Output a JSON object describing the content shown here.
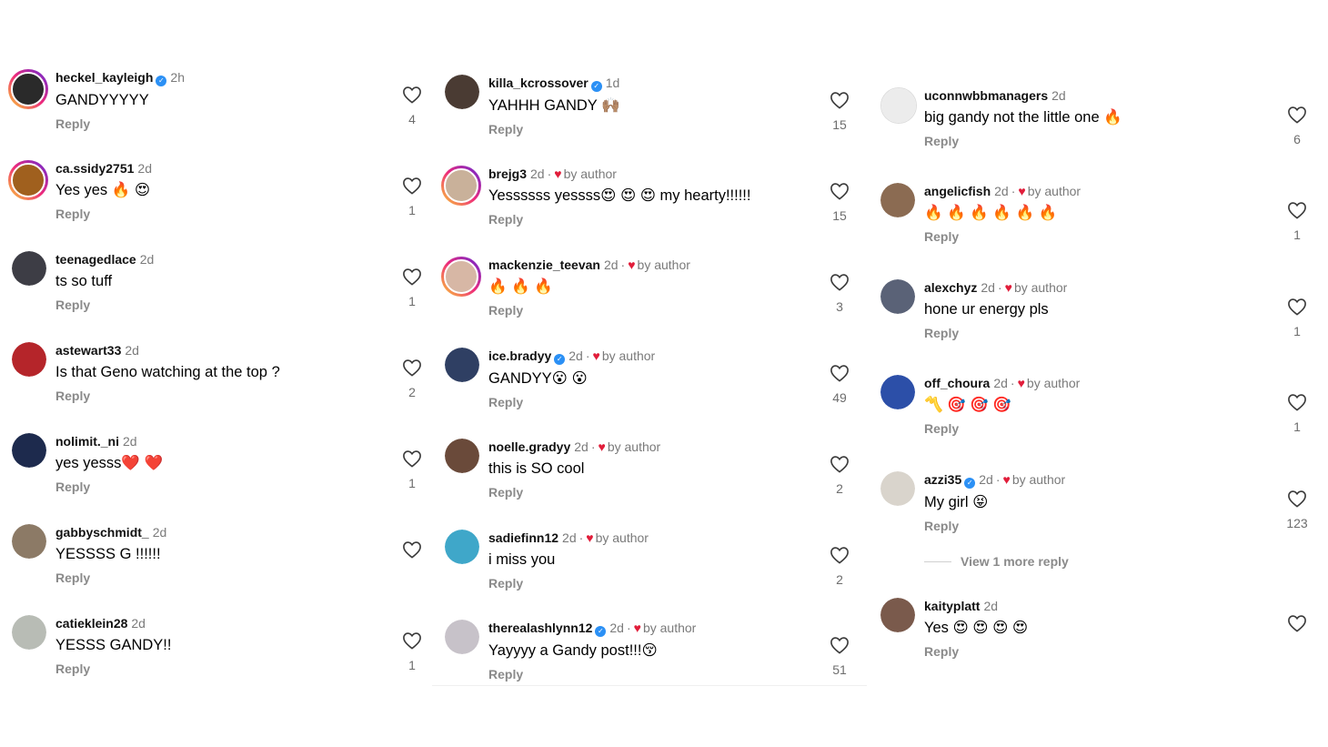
{
  "reply_label": "Reply",
  "by_author_label": "by author",
  "columns": [
    {
      "comments": [
        {
          "user": "heckel_kayleigh",
          "verified": true,
          "time": "2h",
          "by_author": false,
          "text": "GANDYYYYY",
          "likes": "4",
          "avatar_color": "#2a2a2a",
          "ring": true
        },
        {
          "user": "ca.ssidy2751",
          "verified": false,
          "time": "2d",
          "by_author": false,
          "text": "Yes yes 🔥 😍",
          "likes": "1",
          "avatar_color": "#a0601e",
          "ring": true
        },
        {
          "user": "teenagedlace",
          "verified": false,
          "time": "2d",
          "by_author": false,
          "text": "ts so tuff",
          "likes": "1",
          "avatar_color": "#3d3d45",
          "ring": false
        },
        {
          "user": "astewart33",
          "verified": false,
          "time": "2d",
          "by_author": false,
          "text": "Is that Geno watching at the top ?",
          "likes": "2",
          "avatar_color": "#b5252a",
          "ring": false
        },
        {
          "user": "nolimit._ni",
          "verified": false,
          "time": "2d",
          "by_author": false,
          "text": "yes yesss❤️ ❤️",
          "likes": "1",
          "avatar_color": "#1d2a4d",
          "ring": false
        },
        {
          "user": "gabbyschmidt_",
          "verified": false,
          "time": "2d",
          "by_author": false,
          "text": "YESSSS G !!!!!!",
          "likes": "",
          "avatar_color": "#8c7a66",
          "ring": false
        },
        {
          "user": "catieklein28",
          "verified": false,
          "time": "2d",
          "by_author": false,
          "text": "YESSS GANDY!!",
          "likes": "1",
          "avatar_color": "#b8bcb5",
          "ring": false
        }
      ]
    },
    {
      "comments": [
        {
          "user": "killa_kcrossover",
          "verified": true,
          "time": "1d",
          "by_author": false,
          "text": "YAHHH GANDY 🙌🏽",
          "likes": "15",
          "avatar_color": "#4a3b33",
          "ring": false
        },
        {
          "user": "brejg3",
          "verified": false,
          "time": "2d",
          "by_author": true,
          "text": "Yessssss yessss😍 😍 😍  my hearty!!!!!!",
          "likes": "15",
          "avatar_color": "#c9b19a",
          "ring": true
        },
        {
          "user": "mackenzie_teevan",
          "verified": false,
          "time": "2d",
          "by_author": true,
          "text": "🔥 🔥 🔥",
          "likes": "3",
          "avatar_color": "#d7b7a5",
          "ring": true
        },
        {
          "user": "ice.bradyy",
          "verified": true,
          "time": "2d",
          "by_author": true,
          "text": "GANDYY😮 😮",
          "likes": "49",
          "avatar_color": "#2f3f63",
          "ring": false
        },
        {
          "user": "noelle.gradyy",
          "verified": false,
          "time": "2d",
          "by_author": true,
          "text": "this is SO cool",
          "likes": "2",
          "avatar_color": "#6a4a3a",
          "ring": false
        },
        {
          "user": "sadiefinn12",
          "verified": false,
          "time": "2d",
          "by_author": true,
          "text": "i miss you",
          "likes": "2",
          "avatar_color": "#3fa7c9",
          "ring": false
        },
        {
          "user": "therealashlynn12",
          "verified": true,
          "time": "2d",
          "by_author": true,
          "text": "Yayyyy a Gandy post!!!😚",
          "likes": "51",
          "avatar_color": "#c7c2c9",
          "ring": false
        }
      ]
    },
    {
      "comments": [
        {
          "user": "uconnwbbmanagers",
          "verified": false,
          "time": "2d",
          "by_author": false,
          "text": "big gandy not the little one 🔥",
          "likes": "6",
          "avatar_color": "#ececec",
          "ring": false
        },
        {
          "user": "angelicfish",
          "verified": false,
          "time": "2d",
          "by_author": true,
          "text": "🔥 🔥 🔥 🔥 🔥 🔥",
          "likes": "1",
          "avatar_color": "#8b6b52",
          "ring": false
        },
        {
          "user": "alexchyz",
          "verified": false,
          "time": "2d",
          "by_author": true,
          "text": "hone ur energy pls",
          "likes": "1",
          "avatar_color": "#5a6277",
          "ring": false
        },
        {
          "user": "off_choura",
          "verified": false,
          "time": "2d",
          "by_author": true,
          "text": "〽️ 🎯 🎯 🎯",
          "likes": "1",
          "avatar_color": "#2c4fa8",
          "ring": false
        },
        {
          "user": "azzi35",
          "verified": true,
          "time": "2d",
          "by_author": true,
          "text": "My girl 😝",
          "likes": "123",
          "avatar_color": "#d9d4cc",
          "ring": false
        },
        {
          "user": "kaityplatt",
          "verified": false,
          "time": "2d",
          "by_author": false,
          "text": "Yes 😍 😍 😍 😍",
          "likes": "",
          "avatar_color": "#7a5a4c",
          "ring": false
        }
      ],
      "view_more": "View 1 more reply"
    }
  ]
}
